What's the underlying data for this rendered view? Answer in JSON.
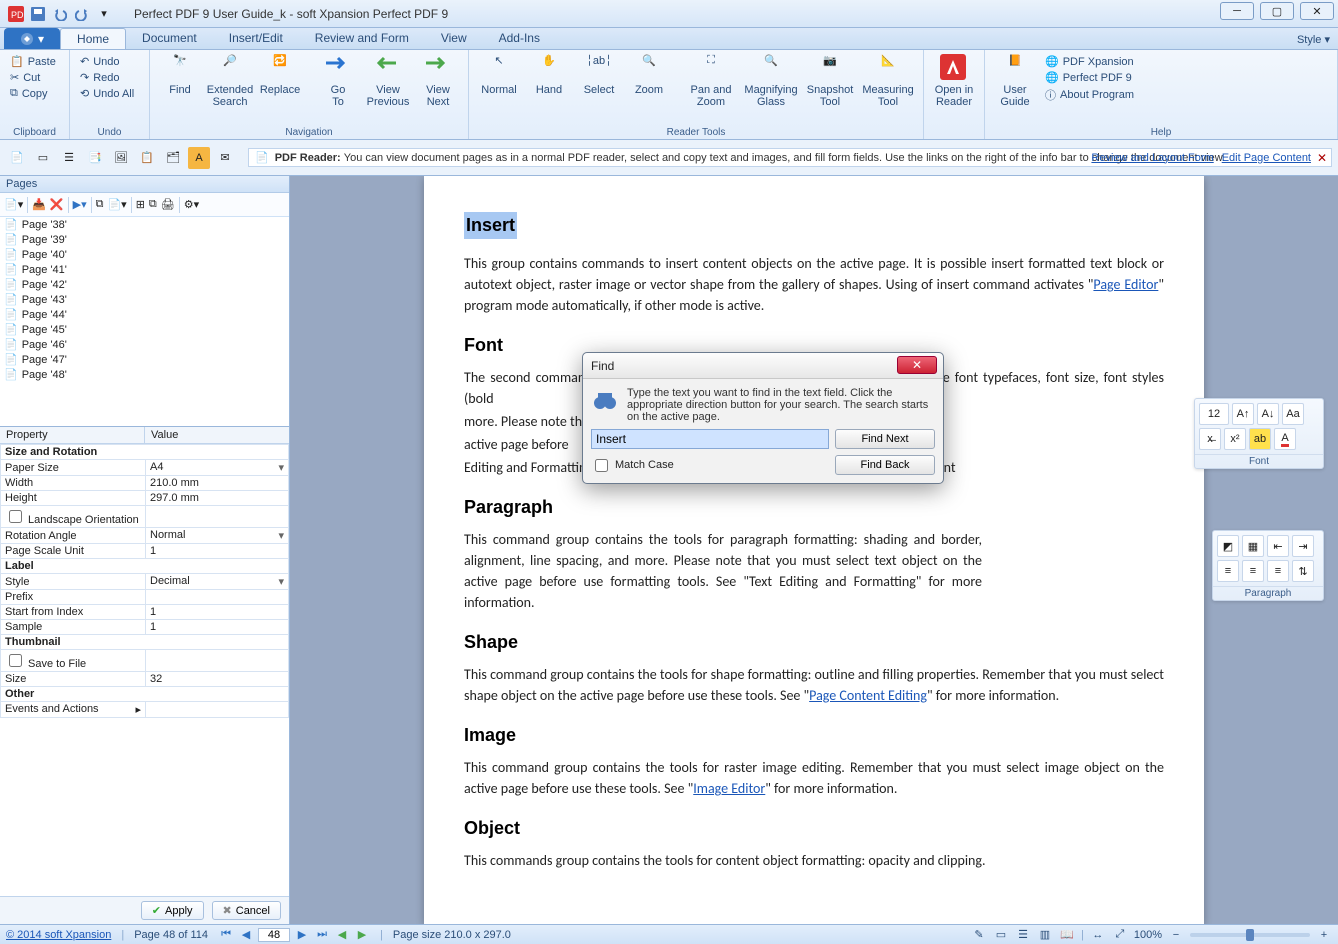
{
  "window": {
    "title": "Perfect PDF 9 User Guide_k - soft Xpansion Perfect PDF 9",
    "style_link": "Style ▾"
  },
  "ribbon_tabs": {
    "file": "",
    "items": [
      "Home",
      "Document",
      "Insert/Edit",
      "Review and Form",
      "View",
      "Add-Ins"
    ],
    "active": 0
  },
  "ribbon": {
    "clipboard": {
      "paste": "Paste",
      "cut": "Cut",
      "copy": "Copy",
      "label": "Clipboard"
    },
    "undo": {
      "undo": "Undo",
      "redo": "Redo",
      "undo_all": "Undo All",
      "label": "Undo"
    },
    "navigation": {
      "find": "Find",
      "extended": "Extended\nSearch",
      "replace": "Replace",
      "goto": "Go\nTo",
      "view_prev": "View\nPrevious",
      "view_next": "View\nNext",
      "label": "Navigation"
    },
    "reader": {
      "normal": "Normal",
      "hand": "Hand",
      "select": "Select",
      "zoom": "Zoom",
      "panzoom": "Pan and\nZoom",
      "mag": "Magnifying\nGlass",
      "snapshot": "Snapshot\nTool",
      "measure": "Measuring\nTool",
      "label": "Reader Tools"
    },
    "open": {
      "open": "Open in\nReader"
    },
    "help": {
      "guide": "User\nGuide",
      "xpansion": "PDF Xpansion",
      "ppdf": "Perfect PDF 9",
      "about": "About Program",
      "label": "Help"
    }
  },
  "infobar": {
    "prefix": "PDF Reader: ",
    "text": "You can view document pages as in a normal PDF reader, select and copy text and images, and fill form fields. Use the links on the right of the info bar to change the document view.",
    "link1": "Review and Layout Form",
    "link2": "Edit Page Content"
  },
  "pages_panel": {
    "title": "Pages",
    "items": [
      "Page '38'",
      "Page '39'",
      "Page '40'",
      "Page '41'",
      "Page '42'",
      "Page '43'",
      "Page '44'",
      "Page '45'",
      "Page '46'",
      "Page '47'",
      "Page '48'"
    ]
  },
  "properties": {
    "headers": [
      "Property",
      "Value"
    ],
    "groups": [
      {
        "name": "Size and Rotation",
        "rows": [
          [
            "Paper Size",
            "A4"
          ],
          [
            "Width",
            "210.0 mm"
          ],
          [
            "Height",
            "297.0 mm"
          ],
          [
            "Landscape Orientation",
            ""
          ],
          [
            "Rotation Angle",
            "Normal"
          ],
          [
            "Page Scale Unit",
            "1"
          ]
        ]
      },
      {
        "name": "Label",
        "rows": [
          [
            "Style",
            "Decimal"
          ],
          [
            "Prefix",
            ""
          ],
          [
            "Start from Index",
            "1"
          ],
          [
            "Sample",
            "1"
          ]
        ]
      },
      {
        "name": "Thumbnail",
        "rows": [
          [
            "Save to File",
            ""
          ],
          [
            "Size",
            "32"
          ]
        ]
      },
      {
        "name": "Other",
        "rows": [
          [
            "Events and Actions",
            ""
          ]
        ]
      }
    ],
    "apply": "Apply",
    "cancel": "Cancel"
  },
  "document": {
    "h_insert": "Insert",
    "p_insert": "This group contains commands to insert content objects on the active page. It is possible insert formatted text block or autotext object, raster image or vector shape from the gallery of shapes. Using of insert command activates \"",
    "link_pe": "Page Editor",
    "p_insert2": "\" program mode automatically, if other mode is active.",
    "h_font": "Font",
    "p_font1": "The second command",
    "p_font1b": "e font typefaces, font size, font styles (bold",
    "p_font2": "more. Please note tha",
    "p_font3": "active page before",
    "p_font4": "Editing and Formattin",
    "p_font_tail": "ont",
    "h_para": "Paragraph",
    "p_para": "This command group contains the tools for paragraph formatting: shading and border, alignment, line spacing, and more. Please note that you must select text object on the active page before use formatting tools. See \"Text Editing and Formatting\" for more information.",
    "h_shape": "Shape",
    "p_shape": "This command group contains the tools for shape formatting: outline and filling properties. Remember that you must select shape object on the active page before use these tools. See \"",
    "link_pce": "Page Content Editing",
    "p_shape2": "\" for more information.",
    "h_image": "Image",
    "p_image": "This command group contains the tools for raster image editing. Remember that you must select image object on the active page before use these tools. See \"",
    "link_ie": "Image Editor",
    "p_image2": "\" for more information.",
    "h_object": "Object",
    "p_object": "This commands group contains the tools for content object formatting: opacity and clipping."
  },
  "mini_font": {
    "label": "Font",
    "size": "12"
  },
  "mini_para": {
    "label": "Paragraph"
  },
  "find_dialog": {
    "title": "Find",
    "blurb": "Type the text you want to find in the text field. Click the appropriate direction button for your search. The search starts on the active page.",
    "value": "Insert",
    "match_case": "Match Case",
    "find_next": "Find Next",
    "find_back": "Find Back"
  },
  "status": {
    "copyright": "© 2014 soft Xpansion",
    "page_info": "Page 48 of 114",
    "page_no": "48",
    "page_size": "Page size 210.0 x 297.0",
    "zoom": "100%"
  }
}
